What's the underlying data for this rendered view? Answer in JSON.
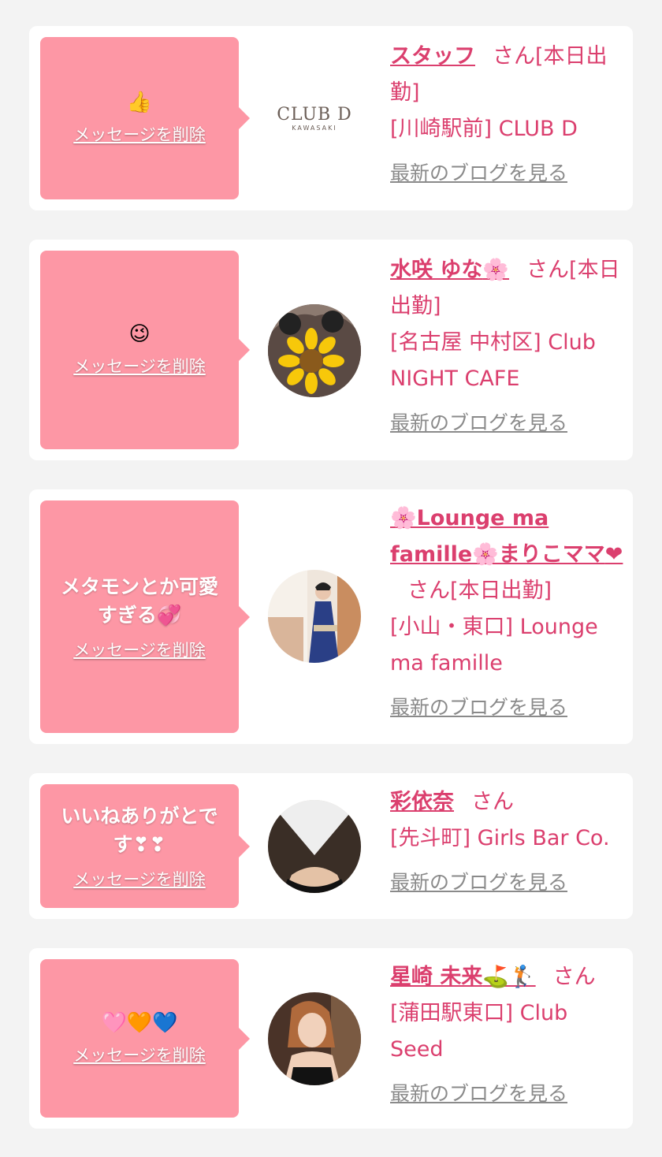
{
  "ui": {
    "delete_label": "メッセージを削除",
    "blog_label": "最新のブログを見る",
    "san_suffix": "さん"
  },
  "colors": {
    "background": "#f3f3f3",
    "card": "#ffffff",
    "bubble": "#fd97a5",
    "accent_text": "#db3f6e",
    "link_gray": "#8a8a8a"
  },
  "cards": [
    {
      "message": "",
      "message_emoji": "👍",
      "name": "スタッフ",
      "name_emoji": "",
      "status": "[本日出勤]",
      "shop": "[川崎駅前] CLUB D",
      "avatar": "club-d-logo",
      "logo_text": "CLUB D",
      "logo_sub": "KAWASAKI"
    },
    {
      "message": "",
      "message_emoji": "😉",
      "name": "水咲 ゆな",
      "name_emoji": "🌸",
      "status": "[本日出勤]",
      "shop": "[名古屋 中村区] Club NIGHT CAFE",
      "avatar": "sunflower-covered-photo"
    },
    {
      "message": "メタモンとか可愛すぎる",
      "message_emoji": "💞",
      "name": "🌸Lounge ma famille🌸まりこママ",
      "name_emoji": "❤",
      "status": "[本日出勤]",
      "shop": "[小山・東口] Lounge ma famille",
      "avatar": "kimono-woman-photo"
    },
    {
      "message": "いいねありがとです",
      "message_emoji": "❣❣",
      "name": "彩依奈",
      "name_emoji": "",
      "status": "",
      "shop": "[先斗町] Girls Bar Co.",
      "avatar": "woman-photo-face-hidden"
    },
    {
      "message": "",
      "message_emoji": "🩷🧡💙",
      "name": "星崎 未来",
      "name_emoji": "⛳🏌",
      "status": "",
      "shop": "[蒲田駅東口] Club Seed",
      "avatar": "woman-portrait-photo"
    }
  ]
}
